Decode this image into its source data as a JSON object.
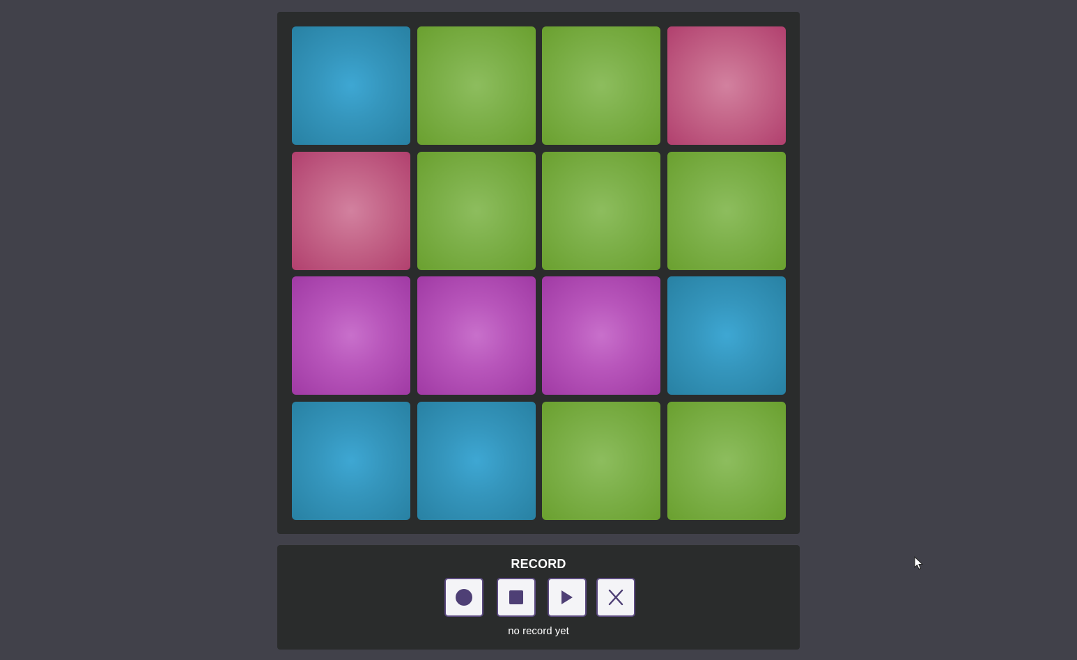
{
  "pads": [
    {
      "color": "blue"
    },
    {
      "color": "green"
    },
    {
      "color": "green"
    },
    {
      "color": "pink"
    },
    {
      "color": "pink"
    },
    {
      "color": "green"
    },
    {
      "color": "green"
    },
    {
      "color": "green"
    },
    {
      "color": "purple"
    },
    {
      "color": "purple"
    },
    {
      "color": "purple"
    },
    {
      "color": "blue"
    },
    {
      "color": "blue"
    },
    {
      "color": "blue"
    },
    {
      "color": "green"
    },
    {
      "color": "green"
    }
  ],
  "recorder": {
    "title": "RECORD",
    "status": "no record yet",
    "buttons": [
      {
        "name": "record-button",
        "icon": "record-circle-icon"
      },
      {
        "name": "stop-button",
        "icon": "stop-square-icon"
      },
      {
        "name": "play-button",
        "icon": "play-triangle-icon"
      },
      {
        "name": "clear-button",
        "icon": "close-x-icon"
      }
    ]
  },
  "colors": {
    "background": "#41414a",
    "panel": "#2a2c2c",
    "icon_accent": "#4e3f75"
  }
}
